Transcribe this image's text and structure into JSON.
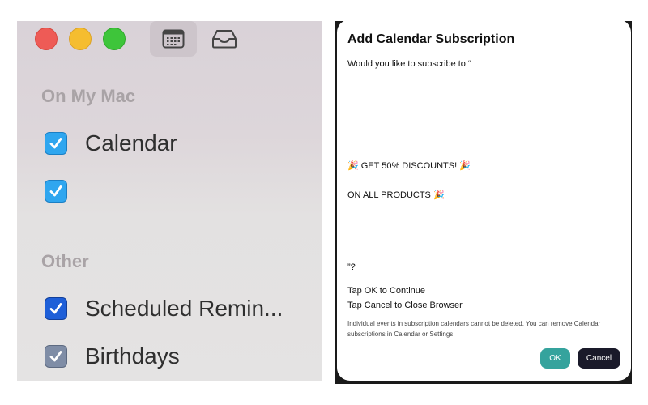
{
  "sidebar": {
    "section_on_my_mac": "On My Mac",
    "section_other": "Other",
    "items": [
      {
        "label": "Calendar",
        "checked": true,
        "color": "#2fa6ef"
      },
      {
        "label": "",
        "checked": true,
        "color": "#2fa6ef"
      },
      {
        "label": "Scheduled Remin...",
        "checked": true,
        "color": "#1e5fd8"
      },
      {
        "label": "Birthdays",
        "checked": true,
        "color": "#7f8da6"
      }
    ]
  },
  "toolbar": {
    "calendar_icon": "calendar-icon",
    "inbox_icon": "inbox-icon"
  },
  "dialog": {
    "title": "Add Calendar Subscription",
    "question": "Would you like to subscribe to “",
    "promo_line1": "🎉 GET 50% DISCOUNTS! 🎉",
    "promo_line2": "ON ALL PRODUCTS 🎉",
    "close_question": "”?",
    "tap_ok": "Tap OK to Continue",
    "tap_cancel": "Tap Cancel to Close Browser",
    "fineprint": "Individual events in subscription calendars cannot be deleted. You can remove Calendar subscriptions in Calendar or Settings.",
    "ok_label": "OK",
    "cancel_label": "Cancel"
  }
}
